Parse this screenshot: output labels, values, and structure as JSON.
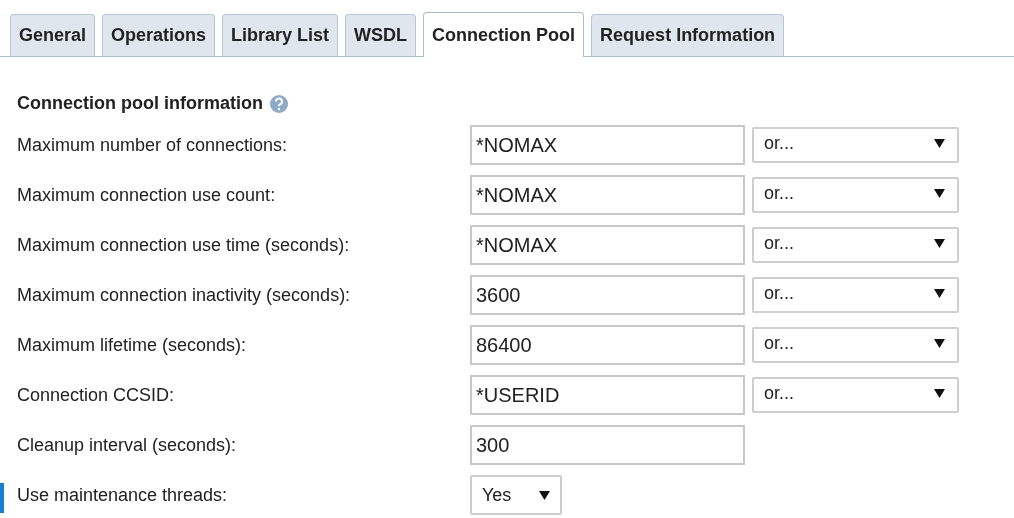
{
  "tabs": [
    {
      "label": "General",
      "selected": false
    },
    {
      "label": "Operations",
      "selected": false
    },
    {
      "label": "Library List",
      "selected": false
    },
    {
      "label": "WSDL",
      "selected": false
    },
    {
      "label": "Connection Pool",
      "selected": true
    },
    {
      "label": "Request Information",
      "selected": false
    }
  ],
  "section": {
    "title": "Connection pool information",
    "help": true
  },
  "rows": [
    {
      "kind": "field_or",
      "label": "Maximum number of connections:",
      "value": "*NOMAX",
      "option": "or..."
    },
    {
      "kind": "field_or",
      "label": "Maximum connection use count:",
      "value": "*NOMAX",
      "option": "or..."
    },
    {
      "kind": "field_or",
      "label": "Maximum connection use time (seconds):",
      "value": "*NOMAX",
      "option": "or..."
    },
    {
      "kind": "field_or",
      "label": "Maximum connection inactivity (seconds):",
      "value": "3600",
      "option": "or..."
    },
    {
      "kind": "field_or",
      "label": "Maximum lifetime (seconds):",
      "value": "86400",
      "option": "or..."
    },
    {
      "kind": "field_or",
      "label": "Connection CCSID:",
      "value": "*USERID",
      "option": "or..."
    },
    {
      "kind": "field",
      "label": "Cleanup interval (seconds):",
      "value": "300"
    },
    {
      "kind": "select",
      "label": "Use maintenance threads:",
      "option": "Yes",
      "marked": true
    }
  ]
}
